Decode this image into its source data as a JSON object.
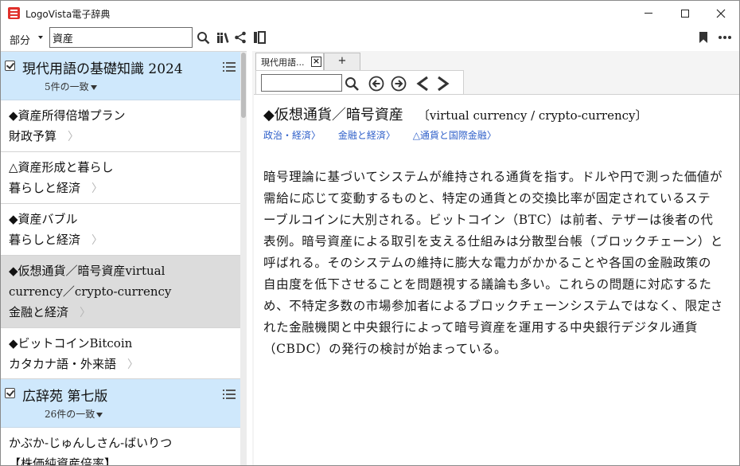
{
  "window": {
    "title": "LogoVista電子辞典"
  },
  "toolbar": {
    "mode_label": "部分",
    "search_value": "資産"
  },
  "results": {
    "groups": [
      {
        "dictionary": "現代用語の基礎知識 2024",
        "count": "5件の一致",
        "entries": [
          {
            "title": "◆資産所得倍増プラン",
            "category": "財政予算"
          },
          {
            "title": "△資産形成と暮らし",
            "category": "暮らしと経済"
          },
          {
            "title": "◆資産バブル",
            "category": "暮らしと経済"
          },
          {
            "title": "◆仮想通貨／暗号資産virtual currency／crypto-currency",
            "category": "金融と経済"
          },
          {
            "title": "◆ビットコインBitcoin",
            "category": "カタカナ語・外来語"
          }
        ]
      },
      {
        "dictionary": "広辞苑 第七版",
        "count": "26件の一致",
        "entries": [
          {
            "title": "かぶか‐じゅんしさん‐ばいりつ",
            "category": "【株価純資産倍率】"
          }
        ]
      }
    ]
  },
  "tabs": [
    {
      "label": "現代用語..."
    },
    {
      "label": "+"
    }
  ],
  "article": {
    "headword": "◆仮想通貨／暗号資産",
    "english": "〔virtual currency / crypto-currency〕",
    "categories": [
      "政治・経済〉",
      "金融と経済〉",
      "△通貨と国際金融〉"
    ],
    "body": "暗号理論に基づいてシステムが維持される通貨を指す。ドルや円で測った価値が需給に応じて変動するものと、特定の通貨との交換比率が固定されているステーブルコインに大別される。ビットコイン（BTC）は前者、テザーは後者の代表例。暗号資産による取引を支える仕組みは分散型台帳（ブロックチェーン）と呼ばれる。そのシステムの維持に膨大な電力がかかることや各国の金融政策の自由度を低下させることを問題視する議論も多い。これらの問題に対応するため、不特定多数の市場参加者によるブロックチェーンシステムではなく、限定された金融機関と中央銀行によって暗号資産を運用する中央銀行デジタル通貨（CBDC）の発行の検討が始まっている。"
  },
  "colors": {
    "dict_header_bg": "#cfe8fc",
    "selected_bg": "#dcdcdc",
    "link_blue": "#2e5fc9",
    "app_icon_red": "#e0312b"
  }
}
